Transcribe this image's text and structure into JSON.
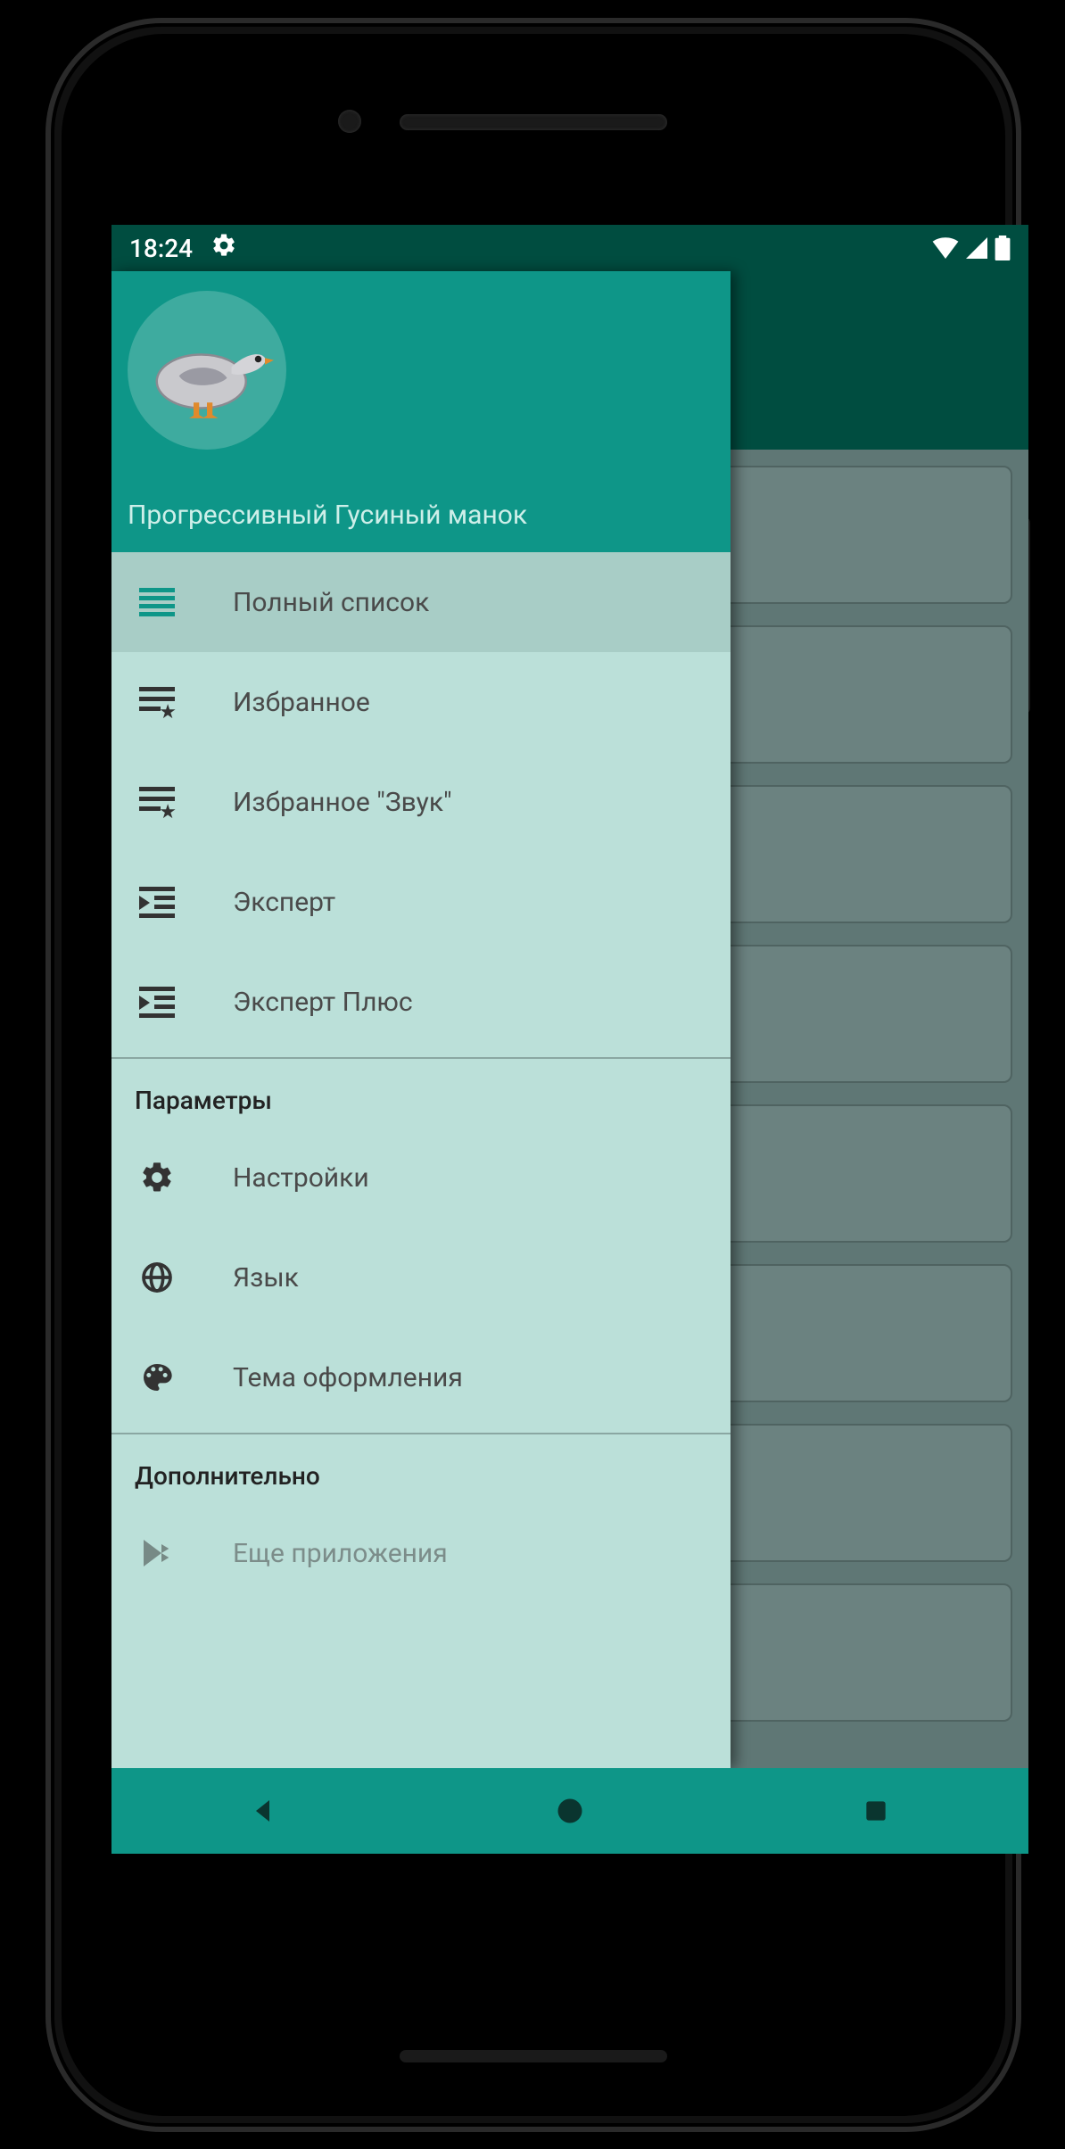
{
  "status": {
    "time": "18:24"
  },
  "drawer": {
    "title": "Прогрессивный Гусиный манок",
    "items": [
      {
        "label": "Полный список"
      },
      {
        "label": "Избранное"
      },
      {
        "label": "Избранное \"Звук\""
      },
      {
        "label": "Эксперт"
      },
      {
        "label": "Эксперт Плюс"
      }
    ],
    "section_parameters": "Параметры",
    "param_items": [
      {
        "label": "Настройки"
      },
      {
        "label": "Язык"
      },
      {
        "label": "Тема оформления"
      }
    ],
    "section_extra": "Дополнительно",
    "extra_items": [
      {
        "label": "Еще приложения"
      }
    ]
  },
  "colors": {
    "primary": "#0e9688",
    "dark": "#004d40",
    "drawer_bg": "#bbe0d9"
  }
}
